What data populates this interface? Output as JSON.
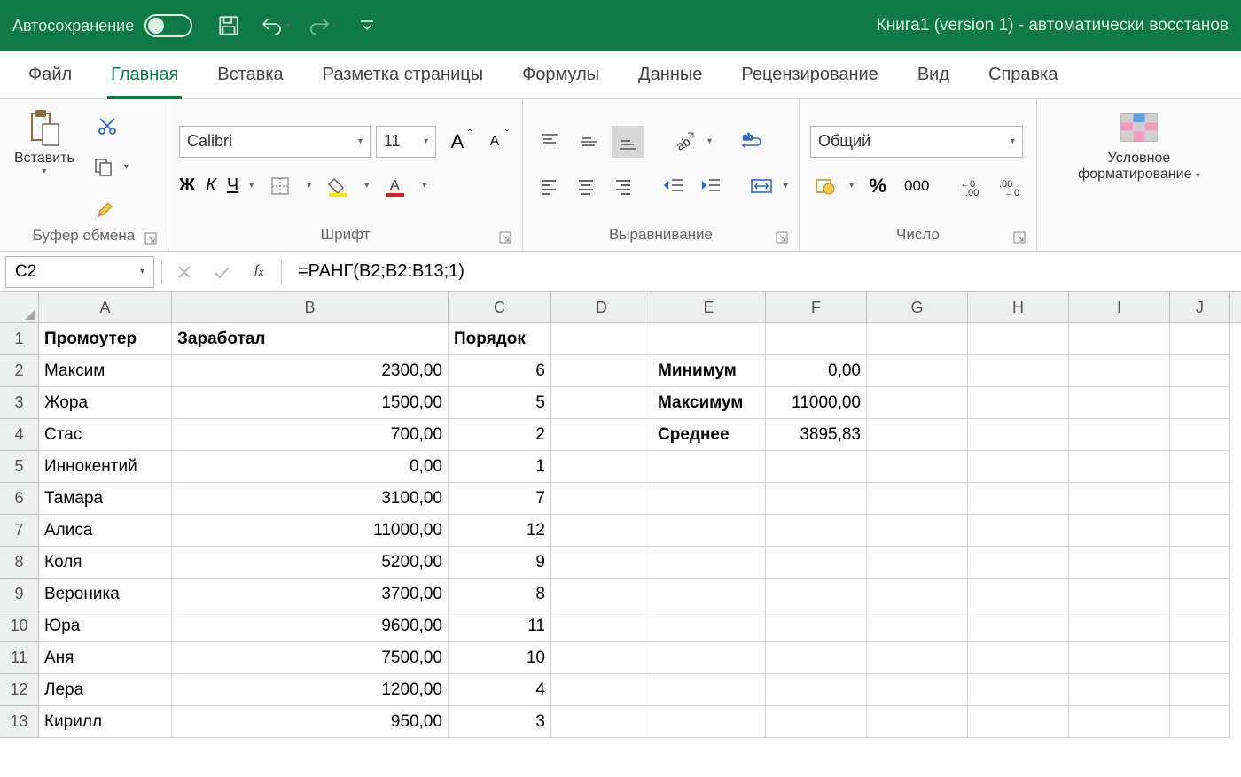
{
  "titlebar": {
    "autosave": "Автосохранение",
    "doc": "Книга1 (version 1)  -  автоматически восстанов"
  },
  "tabs": [
    "Файл",
    "Главная",
    "Вставка",
    "Разметка страницы",
    "Формулы",
    "Данные",
    "Рецензирование",
    "Вид",
    "Справка"
  ],
  "active_tab": 1,
  "ribbon": {
    "clipboard": {
      "paste": "Вставить",
      "label": "Буфер обмена"
    },
    "font": {
      "name": "Calibri",
      "size": "11",
      "label": "Шрифт",
      "bold": "Ж",
      "italic": "К",
      "underline": "Ч",
      "grow": "A",
      "shrink": "A"
    },
    "align": {
      "label": "Выравнивание"
    },
    "number": {
      "format": "Общий",
      "label": "Число"
    },
    "cond": {
      "line1": "Условное",
      "line2": "форматирование"
    }
  },
  "formula_bar": {
    "ref": "C2",
    "formula": "=РАНГ(B2;B2:B13;1)"
  },
  "columns": [
    "A",
    "B",
    "C",
    "D",
    "E",
    "F",
    "G",
    "H",
    "I",
    "J"
  ],
  "headers": {
    "A": "Промоутер",
    "B": "Заработал",
    "C": "Порядок"
  },
  "rows": [
    {
      "n": "1"
    },
    {
      "n": "2",
      "A": "Максим",
      "B": "2300,00",
      "C": "6",
      "E": "Минимум",
      "F": "0,00"
    },
    {
      "n": "3",
      "A": "Жора",
      "B": "1500,00",
      "C": "5",
      "E": "Максимум",
      "F": "11000,00"
    },
    {
      "n": "4",
      "A": "Стас",
      "B": "700,00",
      "C": "2",
      "E": "Среднее",
      "F": "3895,83"
    },
    {
      "n": "5",
      "A": "Иннокентий",
      "B": "0,00",
      "C": "1"
    },
    {
      "n": "6",
      "A": "Тамара",
      "B": "3100,00",
      "C": "7"
    },
    {
      "n": "7",
      "A": "Алиса",
      "B": "11000,00",
      "C": "12"
    },
    {
      "n": "8",
      "A": "Коля",
      "B": "5200,00",
      "C": "9"
    },
    {
      "n": "9",
      "A": "Вероника",
      "B": "3700,00",
      "C": "8"
    },
    {
      "n": "10",
      "A": "Юра",
      "B": "9600,00",
      "C": "11"
    },
    {
      "n": "11",
      "A": "Аня",
      "B": "7500,00",
      "C": "10"
    },
    {
      "n": "12",
      "A": "Лера",
      "B": "1200,00",
      "C": "4"
    },
    {
      "n": "13",
      "A": "Кирилл",
      "B": "950,00",
      "C": "3"
    }
  ],
  "stats_bold_rows": [
    2,
    3,
    4
  ]
}
